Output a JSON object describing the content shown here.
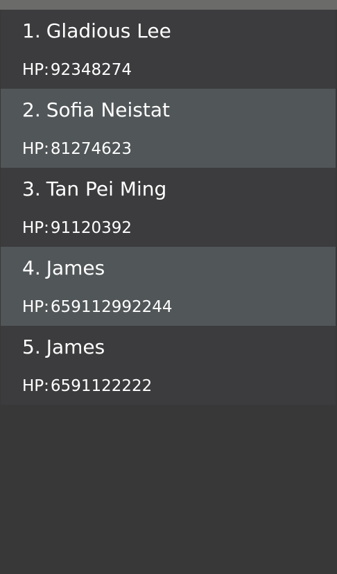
{
  "colors": {
    "top_bar": "#6b6b69",
    "row_dark": "#3c3c3e",
    "row_light": "#515658",
    "background": "#383838",
    "text": "#ffffff"
  },
  "persons": [
    {
      "index": "1.",
      "name": "Gladious Lee",
      "phone_label": "HP:",
      "phone": "92348274"
    },
    {
      "index": "2.",
      "name": "Sofia Neistat",
      "phone_label": "HP:",
      "phone": "81274623"
    },
    {
      "index": "3.",
      "name": "Tan Pei Ming",
      "phone_label": "HP:",
      "phone": "91120392"
    },
    {
      "index": "4.",
      "name": "James",
      "phone_label": "HP:",
      "phone": "659112992244"
    },
    {
      "index": "5.",
      "name": "James",
      "phone_label": "HP:",
      "phone": "6591122222"
    }
  ]
}
